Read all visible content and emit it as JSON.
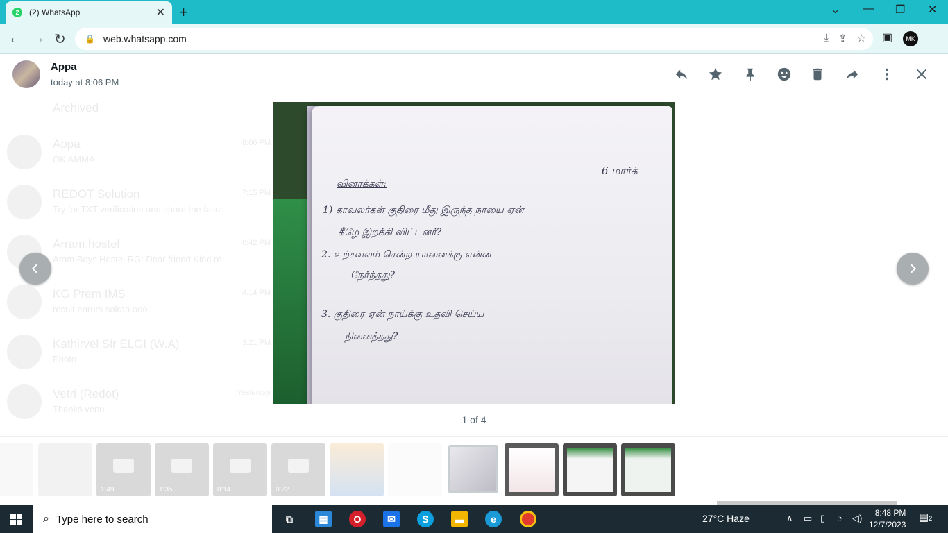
{
  "browser": {
    "tab_title": "(2) WhatsApp",
    "tab_badge": "2",
    "tab_close": "✕",
    "new_tab": "+",
    "url": "web.whatsapp.com",
    "profile_initials": "MK"
  },
  "viewer": {
    "sender_name": "Appa",
    "sender_time": "today at 8:06 PM",
    "counter": "1 of 4",
    "icons": [
      "reply-icon",
      "star-icon",
      "pin-icon",
      "emoji-icon",
      "delete-icon",
      "forward-icon",
      "more-icon",
      "close-icon"
    ]
  },
  "photo_text": {
    "line0": "6 மார்க்",
    "line1": "வினாக்கள்:",
    "line2": "1) காவலர்கள் குதிரை மீது இருந்த நாயை ஏன்",
    "line3": "கீழே இறக்கி விட்டனர்?",
    "line4": "2. உற்சவலம் சென்ற யானைக்கு என்ன",
    "line5": "நேர்ந்தது?",
    "line6": "3. குதிரை ஏன் நாய்க்கு உதவி செய்ய",
    "line7": "நினைத்தது?"
  },
  "background_chats": [
    {
      "name": "Archived",
      "msg": "",
      "time": ""
    },
    {
      "name": "Appa",
      "msg": "OK AMMA",
      "time": "8:06 PM"
    },
    {
      "name": "REDOT Solution",
      "msg": "Try for TXT verification and share the failur...",
      "time": "7:15 PM"
    },
    {
      "name": "Arram hostel",
      "msg": "Aram Boys Hostel RG: Dear friend Kind re...",
      "time": "6:42 PM"
    },
    {
      "name": "KG Prem IMS",
      "msg": "result enrum solran ooo",
      "time": "4:14 PM"
    },
    {
      "name": "Kathirvel Sir ELGI (W.A)",
      "msg": "Photo",
      "time": "3:21 PM"
    },
    {
      "name": "Vetri (Redot)",
      "msg": "Thanks venu",
      "time": "Yesterday"
    }
  ],
  "thumbnails": [
    {
      "label": "",
      "dim": true
    },
    {
      "label": "",
      "dim": true
    },
    {
      "label": "1:49",
      "dim": true
    },
    {
      "label": "1:35",
      "dim": true
    },
    {
      "label": "0:14",
      "dim": true
    },
    {
      "label": "0:22",
      "dim": true
    },
    {
      "label": "",
      "dim": true
    },
    {
      "label": "",
      "dim": true
    },
    {
      "label": "",
      "dim": false
    },
    {
      "label": "",
      "dim": false
    },
    {
      "label": "",
      "dim": false
    },
    {
      "label": "",
      "dim": false
    }
  ],
  "taskbar": {
    "search_placeholder": "Type here to search",
    "weather": "27°C  Haze",
    "time": "8:48 PM",
    "date": "12/7/2023",
    "notifications": "2"
  },
  "colors": {
    "chrome_tabbar": "#1ebcc8",
    "chrome_toolbar": "#e6f7f8",
    "whatsapp_icon": "#54656f",
    "taskbar": "#1c2b33"
  }
}
